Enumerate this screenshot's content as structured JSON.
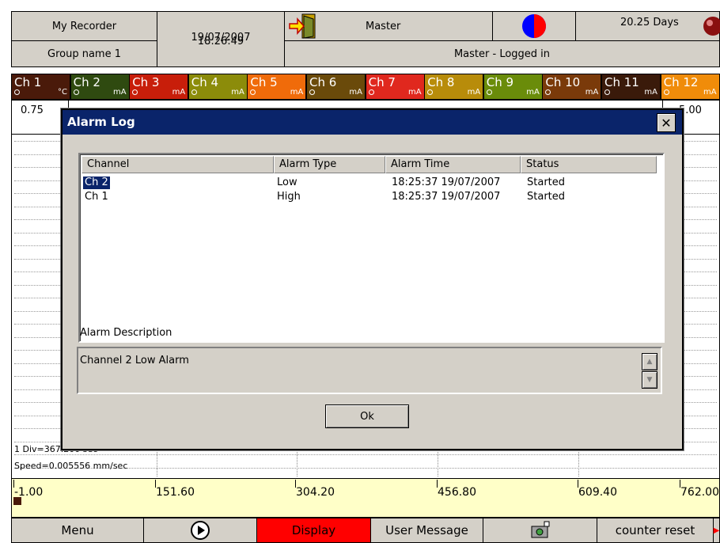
{
  "header": {
    "recorder_name": "My Recorder",
    "group_name": "Group name 1",
    "time": "18:26:49",
    "date": "19/07/2007",
    "user": "Master",
    "login_status": "Master - Logged in",
    "days_remaining": "20.25 Days"
  },
  "channels": [
    {
      "label": "Ch 1",
      "unit": "°C",
      "color": "#4a1a0a"
    },
    {
      "label": "Ch 2",
      "unit": "mA",
      "color": "#2f4a10"
    },
    {
      "label": "Ch 3",
      "unit": "mA",
      "color": "#c81e0a"
    },
    {
      "label": "Ch 4",
      "unit": "mA",
      "color": "#8c8c0a"
    },
    {
      "label": "Ch 5",
      "unit": "mA",
      "color": "#f06b0a"
    },
    {
      "label": "Ch 6",
      "unit": "mA",
      "color": "#6a4a0a"
    },
    {
      "label": "Ch 7",
      "unit": "mA",
      "color": "#e0281e"
    },
    {
      "label": "Ch 8",
      "unit": "mA",
      "color": "#b88c0a"
    },
    {
      "label": "Ch 9",
      "unit": "mA",
      "color": "#6a8c0a"
    },
    {
      "label": "Ch 10",
      "unit": "mA",
      "color": "#7a3a0a"
    },
    {
      "label": "Ch 11",
      "unit": "mA",
      "color": "#3a1a0a"
    },
    {
      "label": "Ch 12",
      "unit": "mA",
      "color": "#f08c0a"
    }
  ],
  "readings": {
    "ch1_value": "0.75",
    "ch12_value": "5.00"
  },
  "chart": {
    "division": "1 Div=367.200 sec",
    "speed": "Speed=0.005556 mm/sec",
    "scale_ticks": [
      "-1.00",
      "151.60",
      "304.20",
      "456.80",
      "609.40",
      "762.00"
    ]
  },
  "dialog": {
    "title": "Alarm Log",
    "columns": [
      "Channel",
      "Alarm Type",
      "Alarm Time",
      "Status"
    ],
    "rows": [
      {
        "channel": "Ch 2",
        "type": "Low",
        "time": "18:25:37 19/07/2007",
        "status": "Started"
      },
      {
        "channel": "Ch 1",
        "type": "High",
        "time": "18:25:37 19/07/2007",
        "status": "Started"
      }
    ],
    "description_label": "Alarm Description",
    "description": "Channel 2 Low Alarm",
    "ok_label": "Ok"
  },
  "toolbar": {
    "menu": "Menu",
    "display": "Display",
    "user_message": "User Message",
    "counter_reset": "counter reset"
  }
}
